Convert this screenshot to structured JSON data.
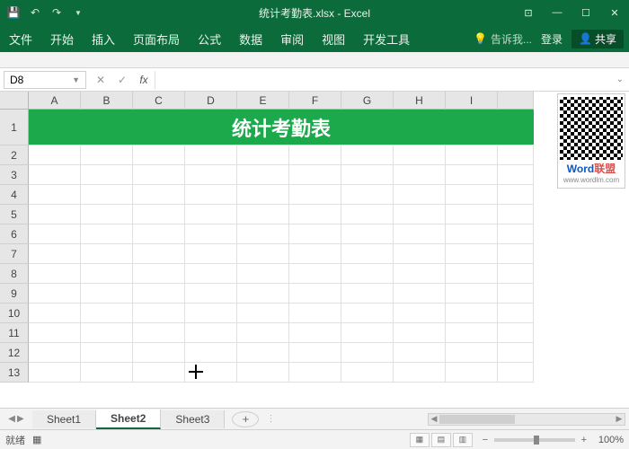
{
  "titlebar": {
    "filename": "统计考勤表.xlsx - Excel"
  },
  "ribbon": {
    "tabs": [
      "文件",
      "开始",
      "插入",
      "页面布局",
      "公式",
      "数据",
      "审阅",
      "视图",
      "开发工具"
    ],
    "tell_me": "告诉我...",
    "signin": "登录",
    "share": "共享"
  },
  "formula": {
    "namebox": "D8",
    "fx": "fx"
  },
  "sheet": {
    "cols": [
      "A",
      "B",
      "C",
      "D",
      "E",
      "F",
      "G",
      "H",
      "I"
    ],
    "rows": [
      1,
      2,
      3,
      4,
      5,
      6,
      7,
      8,
      9,
      10,
      11,
      12,
      13
    ],
    "merged_title": "统计考勤表"
  },
  "tabs": {
    "items": [
      "Sheet1",
      "Sheet2",
      "Sheet3"
    ],
    "active": 1
  },
  "status": {
    "ready": "就绪",
    "scroll_lock_icon": "⊞",
    "zoom": "100%"
  },
  "qr": {
    "brand_a": "Word",
    "brand_b": "联盟",
    "url": "www.wordlm.com"
  }
}
